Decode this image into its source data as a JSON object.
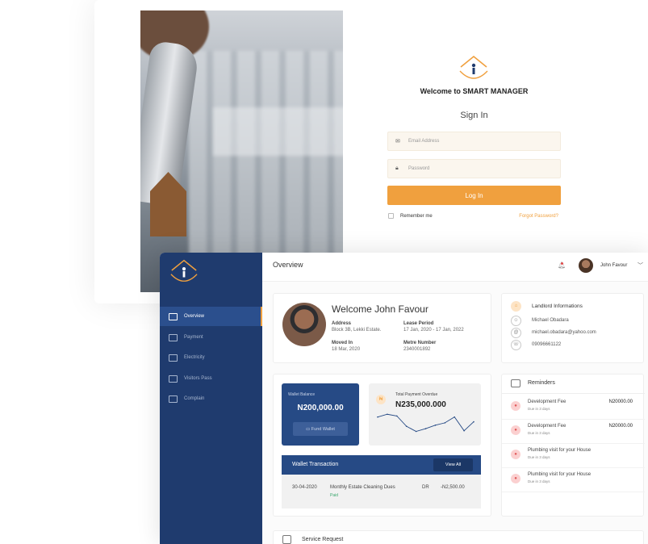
{
  "login": {
    "welcome": "Welcome to SMART MANAGER",
    "sign_in": "Sign In",
    "email_placeholder": "Email Address",
    "password_placeholder": "Password",
    "login_button": "Log In",
    "remember_me": "Remember me",
    "forgot_password": "Forgot Password?"
  },
  "sidebar": {
    "items": [
      {
        "label": "Overview",
        "icon": "layout-icon",
        "active": true
      },
      {
        "label": "Payment",
        "icon": "card-icon"
      },
      {
        "label": "Electricity",
        "icon": "plug-icon"
      },
      {
        "label": "Visitors Pass",
        "icon": "pass-icon"
      },
      {
        "label": "Complain",
        "icon": "complain-icon"
      }
    ]
  },
  "header": {
    "title": "Overview",
    "user_name": "John Favour"
  },
  "profile": {
    "welcome": "Welcome John Favour",
    "address_label": "Address",
    "address_value": "Block 3B, Lekki Estate.",
    "lease_label": "Lease Period",
    "lease_value": "17 Jan, 2020 - 17 Jan, 2022",
    "moved_label": "Moved In",
    "moved_value": "18 Mar, 2020",
    "metre_label": "Metre Number",
    "metre_value": "2340001892"
  },
  "landlord": {
    "title": "Landlord Informations",
    "name": "Michael Obadara",
    "email": "michael.obadara@yahoo.com",
    "phone": "09096661122"
  },
  "wallet": {
    "balance_label": "Wallet Balance",
    "balance_value": "N200,000.00",
    "fund_button": "Fund Wallet",
    "overdue_label": "Total Payment Overdue",
    "overdue_value": "N235,000.000"
  },
  "chart_data": {
    "type": "line",
    "title": "",
    "xlabel": "",
    "ylabel": "",
    "values": [
      62,
      70,
      65,
      35,
      20,
      28,
      38,
      45,
      62,
      22,
      48
    ]
  },
  "transactions": {
    "title": "Wallet Transaction",
    "view_all": "View All",
    "rows": [
      {
        "date": "30-04-2020",
        "description": "Monthly Estate Cleaning Dues",
        "status": "Paid",
        "type": "DR",
        "amount": "-N2,500.00"
      }
    ]
  },
  "reminders": {
    "title": "Reminders",
    "items": [
      {
        "name": "Development Fee",
        "due": "Due in 3 days",
        "amount": "N20000.00"
      },
      {
        "name": "Development Fee",
        "due": "Due in 3 days",
        "amount": "N20000.00"
      },
      {
        "name": "Plumbing visit for your House",
        "due": "Due in 3 days",
        "amount": ""
      },
      {
        "name": "Plumbing visit for your House",
        "due": "Due in 3 days",
        "amount": ""
      }
    ]
  },
  "service": {
    "title": "Service Request"
  },
  "colors": {
    "accent": "#f0a03e",
    "sidebar": "#1f3b6e",
    "card_blue": "#264a85",
    "reminder_icon": "#fbd0d0"
  }
}
